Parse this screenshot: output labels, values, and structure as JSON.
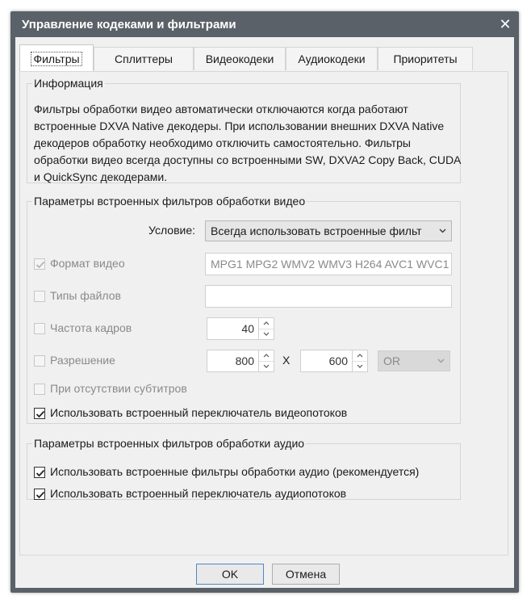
{
  "window": {
    "title": "Управление кодеками и фильтрами"
  },
  "tabs": [
    {
      "label": "Фильтры"
    },
    {
      "label": "Сплиттеры"
    },
    {
      "label": "Видеокодеки"
    },
    {
      "label": "Аудиокодеки"
    },
    {
      "label": "Приоритеты"
    }
  ],
  "info": {
    "legend": "Информация",
    "text": "Фильтры обработки видео автоматически отключаются когда работают встроенные DXVA Native декодеры. При использовании внешних DXVA Native декодеров обработку необходимо отключить самостоятельно. Фильтры обработки видео всегда доступны со встроенными SW, DXVA2 Copy Back, CUDA и QuickSync декодерами."
  },
  "video": {
    "legend": "Параметры встроенных фильтров обработки видео",
    "condition_label": "Условие:",
    "condition_value": "Всегда использовать встроенные фильт",
    "format_label": "Формат видео",
    "format_value": "MPG1 MPG2 WMV2 WMV3 H264 AVC1 WVC1",
    "filetypes_label": "Типы файлов",
    "filetypes_value": "",
    "framerate_label": "Частота кадров",
    "framerate_value": "40",
    "resolution_label": "Разрешение",
    "res_width": "800",
    "res_x": "X",
    "res_height": "600",
    "res_op": "OR",
    "nosubs_label": "При отсутствии субтитров",
    "switcher_label": "Использовать встроенный переключатель видеопотоков"
  },
  "audio": {
    "legend": "Параметры встроенных фильтров обработки аудио",
    "filters_label": "Использовать встроенные фильтры обработки аудио (рекомендуется)",
    "switcher_label": "Использовать встроенный переключатель аудиопотоков"
  },
  "buttons": {
    "ok": "OK",
    "cancel": "Отмена"
  },
  "colors": {
    "titlebar": "#5b6168",
    "client": "#f0f0f0",
    "ok_border": "#4d89c6"
  }
}
